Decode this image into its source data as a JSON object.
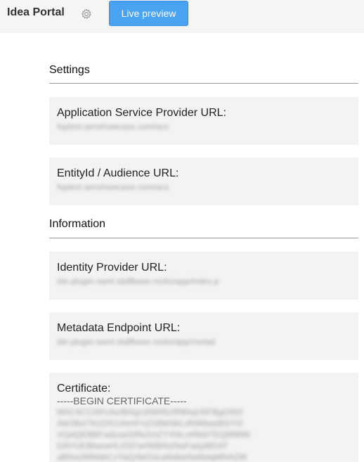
{
  "header": {
    "app_title": "Idea Portal",
    "settings_icon": "gear-icon",
    "live_preview_label": "Live preview",
    "accent_color": "#4aa3f0"
  },
  "settings": {
    "title": "Settings",
    "asp_url": {
      "label": "Application Service Provider URL:",
      "value": "fsptest.iamshowcase.com/acs"
    },
    "entity_id": {
      "label": "EntityId / Audience URL:",
      "value": "fsptest.iamshowcase.com/acs"
    }
  },
  "information": {
    "title": "Information",
    "idp_url": {
      "label": "Identity Provider URL:",
      "value": "ide-plugin-saml.staffbase.rocks/app/index.p"
    },
    "metadata_url": {
      "label": "Metadata Endpoint URL:",
      "value": "ide-plugin-saml.staffbase.rocks/app/metad"
    },
    "certificate": {
      "label": "Certificate:",
      "begin": "-----BEGIN CERTIFICATE-----",
      "lines": [
        "MIIC4CCAPzAoIBAgIJAM45zRWwjU5FBgOlS0",
        "AbOBd7N1DA1nhmFnZGBbNbLdNWbwdKbTO",
        "VQdQEBBFadzaaSRkZmZYXNLmRkbTEQMMiM",
        "DAYUEBbwwHLEEFaHNfbNzNaFadyMDAT",
        "aBNa2MNbbCzYaQAbGdcaNdbeNaNdqMNAZM"
      ]
    }
  }
}
